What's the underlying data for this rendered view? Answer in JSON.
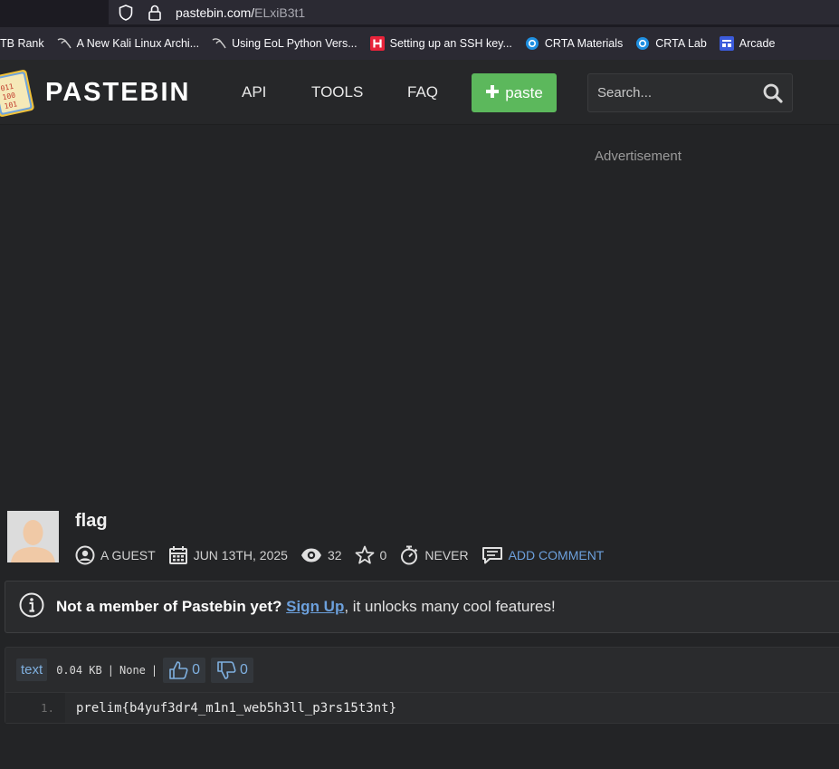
{
  "browser": {
    "url_host": "pastebin.com/",
    "url_path": "ELxiB3t1"
  },
  "bookmarks": [
    {
      "label": "TB Rank",
      "icon": "none"
    },
    {
      "label": "A New Kali Linux Archi...",
      "icon": "kali-dragon-icon"
    },
    {
      "label": "Using EoL Python Vers...",
      "icon": "kali-dragon-icon"
    },
    {
      "label": "Setting up an SSH key...",
      "icon": "h-icon"
    },
    {
      "label": "CRTA Materials",
      "icon": "crta-icon"
    },
    {
      "label": "CRTA Lab",
      "icon": "crta-icon"
    },
    {
      "label": "Arcade",
      "icon": "arcade-icon"
    }
  ],
  "header": {
    "brand": "PASTEBIN",
    "nav": [
      "API",
      "TOOLS",
      "FAQ"
    ],
    "paste_button": "paste",
    "search_placeholder": "Search..."
  },
  "ad_label": "Advertisement",
  "paste": {
    "title": "flag",
    "author": "A GUEST",
    "date": "JUN 13TH, 2025",
    "views": "32",
    "stars": "0",
    "expiry": "NEVER",
    "add_comment": "ADD COMMENT"
  },
  "notice": {
    "bold_text": "Not a member of Pastebin yet?",
    "signup_link": "Sign Up",
    "rest_text": ", it unlocks many cool features!"
  },
  "code": {
    "language": "text",
    "size": "0.04 KB",
    "separator1": "|",
    "category": "None",
    "separator2": "|",
    "likes": "0",
    "dislikes": "0",
    "lines": [
      {
        "number": "1.",
        "text": "prelim{b4yuf3dr4_m1n1_web5h3ll_p3rs15t3nt}"
      }
    ]
  },
  "colors": {
    "accent_green": "#5cb85c",
    "link_blue": "#6ca0dc",
    "background": "#232426"
  }
}
